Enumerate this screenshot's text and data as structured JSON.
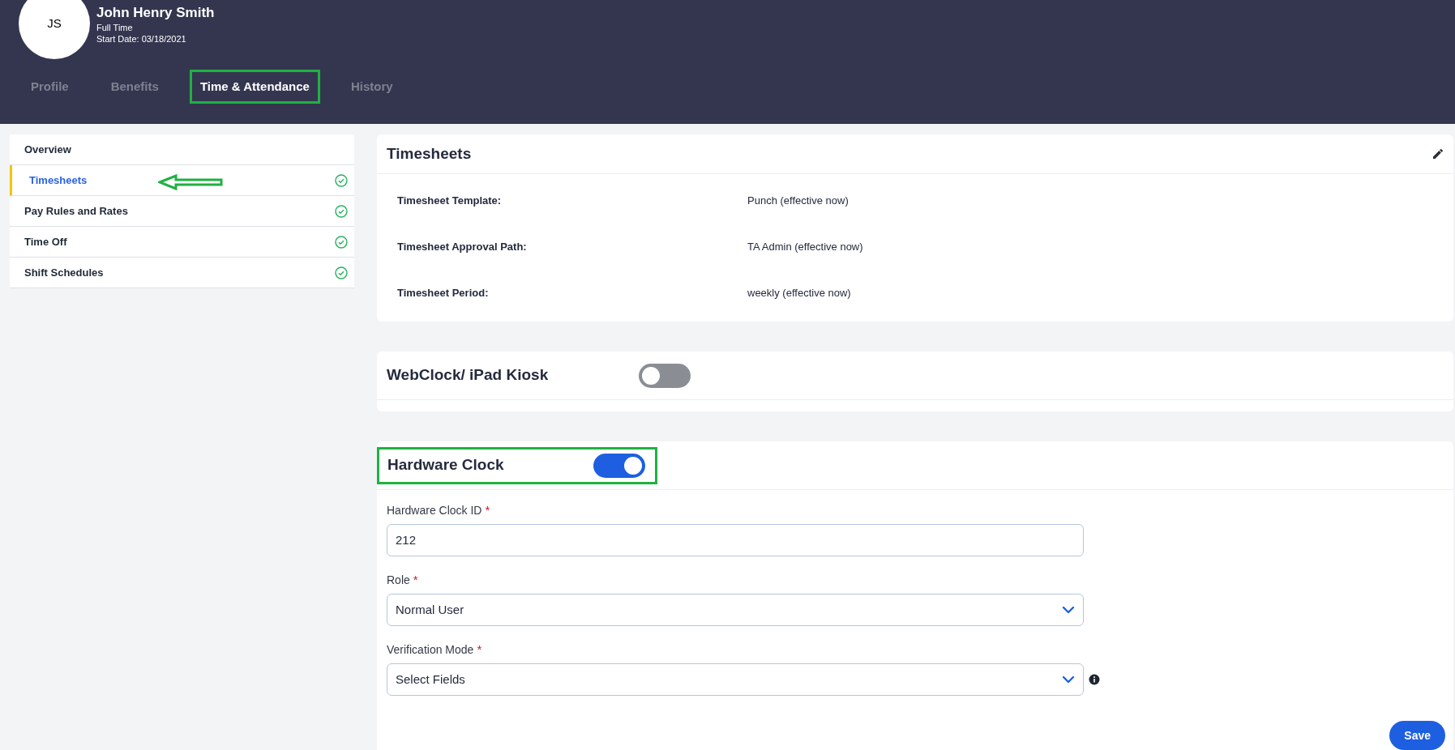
{
  "employee": {
    "initials": "JS",
    "name": "John Henry Smith",
    "type": "Full Time",
    "start_date": "Start Date: 03/18/2021"
  },
  "tabs": [
    {
      "label": "Profile",
      "selected": false
    },
    {
      "label": "Benefits",
      "selected": false
    },
    {
      "label": "Time & Attendance",
      "selected": true
    },
    {
      "label": "History",
      "selected": false
    }
  ],
  "sidebar": {
    "items": [
      {
        "label": "Overview",
        "selected": false,
        "complete": false
      },
      {
        "label": "Timesheets",
        "selected": true,
        "complete": true
      },
      {
        "label": "Pay Rules and Rates",
        "selected": false,
        "complete": true
      },
      {
        "label": "Time Off",
        "selected": false,
        "complete": true
      },
      {
        "label": "Shift Schedules",
        "selected": false,
        "complete": true
      }
    ]
  },
  "timesheets": {
    "title": "Timesheets",
    "rows": [
      {
        "label": "Timesheet Template:",
        "value": "Punch (effective now)"
      },
      {
        "label": "Timesheet Approval Path:",
        "value": "TA Admin (effective now)"
      },
      {
        "label": "Timesheet Period:",
        "value": "weekly (effective now)"
      }
    ]
  },
  "webclock": {
    "title": "WebClock/ iPad Kiosk",
    "on": false
  },
  "hardware_clock": {
    "title": "Hardware Clock",
    "on": true,
    "fields": [
      {
        "kind": "text",
        "label": "Hardware Clock ID",
        "required_mark": "*",
        "value": "212",
        "info": false
      },
      {
        "kind": "select",
        "label": "Role",
        "required_mark": "*",
        "value": "Normal User",
        "info": false
      },
      {
        "kind": "select",
        "label": "Verification Mode",
        "required_mark": "*",
        "value": "Select Fields",
        "info": true
      }
    ],
    "save": "Save"
  }
}
